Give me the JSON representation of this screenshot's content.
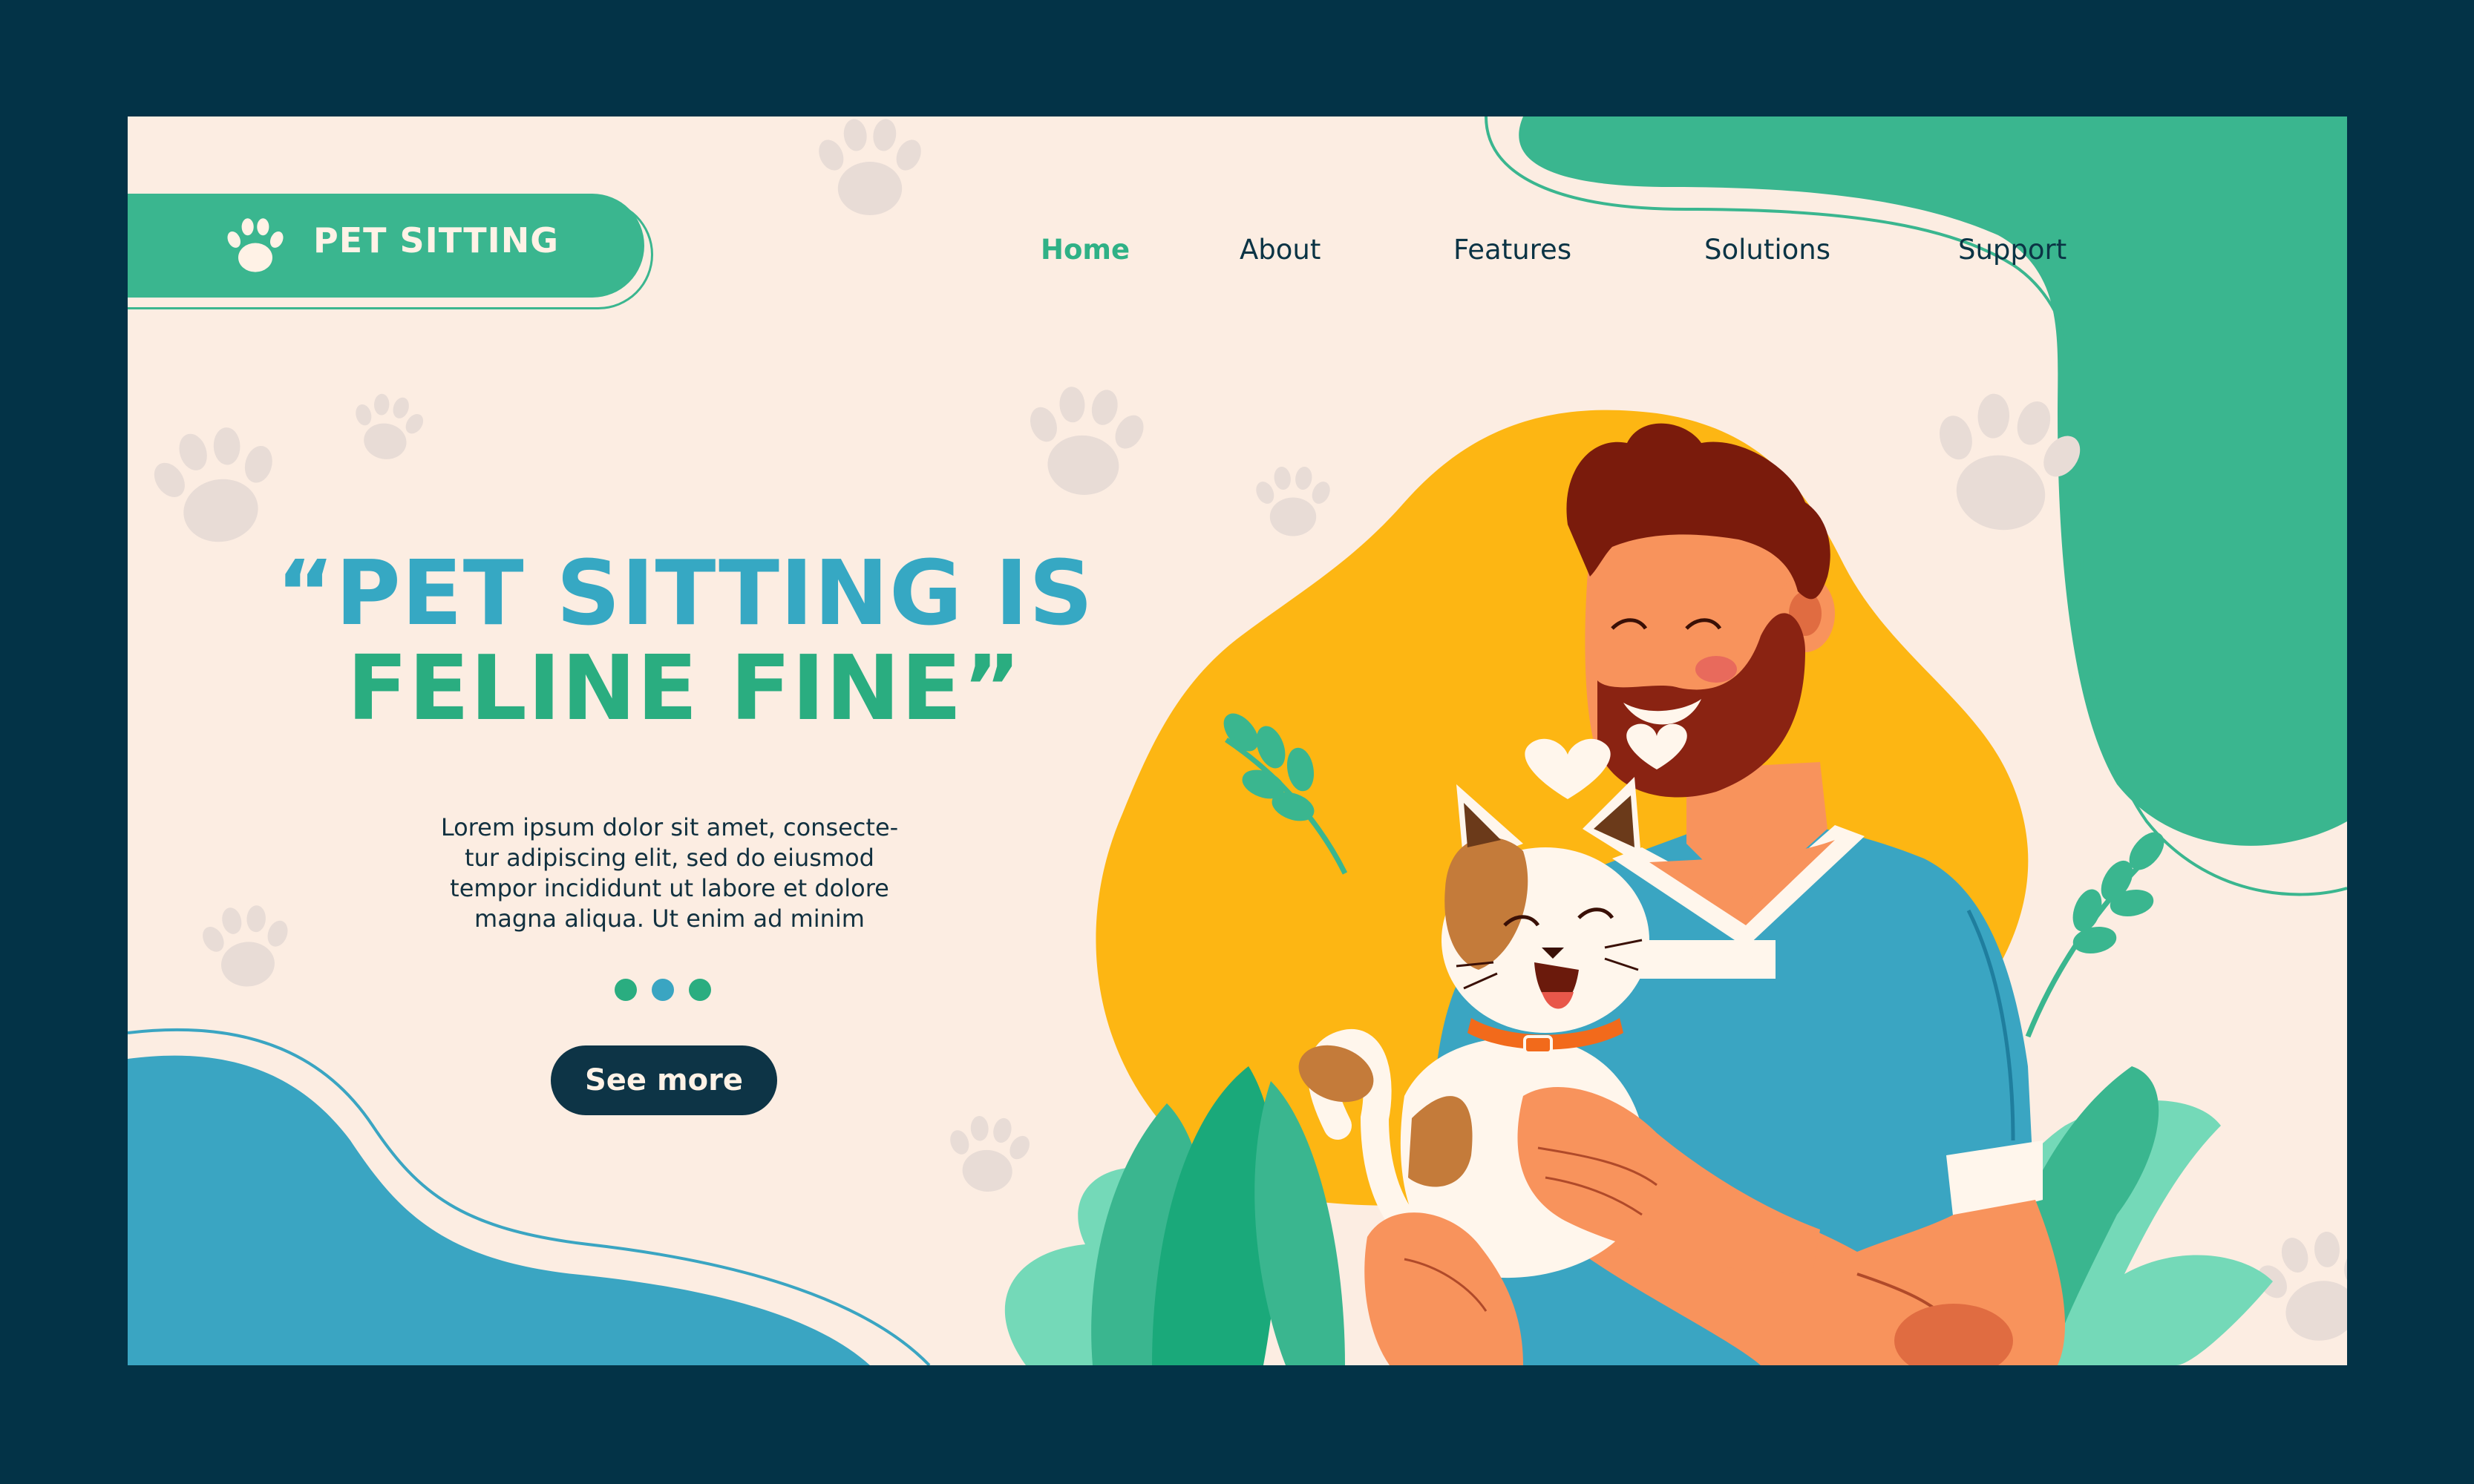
{
  "brand": {
    "name": "PET SITTING",
    "logo_icon": "paw-icon"
  },
  "nav": {
    "items": [
      {
        "label": "Home",
        "active": true
      },
      {
        "label": "About",
        "active": false
      },
      {
        "label": "Features",
        "active": false
      },
      {
        "label": "Solutions",
        "active": false
      },
      {
        "label": "Support",
        "active": false
      }
    ]
  },
  "hero": {
    "headline_line1": "“PET SITTING IS",
    "headline_line2": "FELINE FINE”",
    "body_lines": [
      "Lorem ipsum dolor sit amet, consecte-",
      "tur adipiscing elit, sed do eiusmod",
      "tempor incididunt ut labore et dolore",
      "magna aliqua. Ut enim ad minim"
    ],
    "carousel_dots": 3,
    "carousel_active_index": 1,
    "cta_label": "See more"
  },
  "colors": {
    "frame": "#033347",
    "background": "#fcede2",
    "green": "#3ab68f",
    "teal": "#3aa5c2",
    "yellow": "#fdb613",
    "navy": "#0d3446",
    "paw": "#e8dcd6"
  }
}
